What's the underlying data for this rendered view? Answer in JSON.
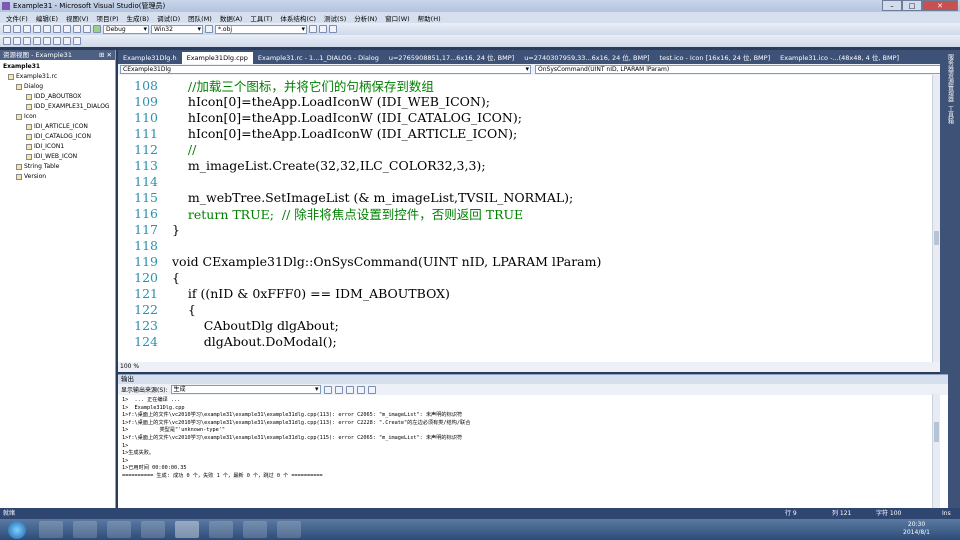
{
  "window": {
    "title": "Example31 - Microsoft Visual Studio(管理员)",
    "minimize": "–",
    "maximize": "□",
    "close": "✕"
  },
  "menu": [
    "文件(F)",
    "编辑(E)",
    "视图(V)",
    "项目(P)",
    "生成(B)",
    "调试(D)",
    "团队(M)",
    "数据(A)",
    "工具(T)",
    "体系结构(C)",
    "测试(S)",
    "分析(N)",
    "窗口(W)",
    "帮助(H)"
  ],
  "toolbar": {
    "config": "Debug",
    "platform": "Win32",
    "find": "*.obj"
  },
  "solution": {
    "header": "资源视图 - Example31",
    "items": [
      "Example31",
      "Example31.rc",
      "Dialog",
      "IDD_ABOUTBOX",
      "IDD_EXAMPLE31_DIALOG",
      "Icon",
      "IDI_ARTICLE_ICON",
      "IDI_CATALOG_ICON",
      "IDI_ICON1",
      "IDI_WEB_ICON",
      "String Table",
      "Version"
    ]
  },
  "tabs": [
    "Example31Dlg.h",
    "Example31Dlg.cpp",
    "Example31.rc - 1...1_DIALOG - Dialog",
    "u=2765908851,17...6x16, 24 位, BMP]",
    "u=2740307959,33...6x16, 24 位, BMP]",
    "test.ico - Icon [16x16, 24 位, BMP]",
    "Example31.ico -...(48x48, 4 位, BMP]"
  ],
  "nav": {
    "class": "CExample31Dlg",
    "member": "OnSysCommand(UINT nID, LPARAM lParam)"
  },
  "code": [
    {
      "n": "108",
      "t": "    //加载三个图标，并将它们的句柄保存到数组",
      "c": "cm"
    },
    {
      "n": "109",
      "t": "    hIcon[0]=theApp.LoadIconW (IDI_WEB_ICON);",
      "c": ""
    },
    {
      "n": "110",
      "t": "    hIcon[0]=theApp.LoadIconW (IDI_CATALOG_ICON);",
      "c": ""
    },
    {
      "n": "111",
      "t": "    hIcon[0]=theApp.LoadIconW (IDI_ARTICLE_ICON);",
      "c": ""
    },
    {
      "n": "112",
      "t": "    //",
      "c": "cm"
    },
    {
      "n": "113",
      "t": "    m_imageList.Create(32,32,ILC_COLOR32,3,3);",
      "c": ""
    },
    {
      "n": "114",
      "t": "",
      "c": ""
    },
    {
      "n": "115",
      "t": "    m_webTree.SetImageList (& m_imageList,TVSIL_NORMAL);",
      "c": ""
    },
    {
      "n": "116",
      "t": "    return TRUE;  // 除非将焦点设置到控件，否则返回 TRUE",
      "c": "mix"
    },
    {
      "n": "117",
      "t": "}",
      "c": ""
    },
    {
      "n": "118",
      "t": "",
      "c": ""
    },
    {
      "n": "119",
      "t": "void CExample31Dlg::OnSysCommand(UINT nID, LPARAM lParam)",
      "c": "fn"
    },
    {
      "n": "120",
      "t": "{",
      "c": ""
    },
    {
      "n": "121",
      "t": "    if ((nID & 0xFFF0) == IDM_ABOUTBOX)",
      "c": "if"
    },
    {
      "n": "122",
      "t": "    {",
      "c": ""
    },
    {
      "n": "123",
      "t": "        CAboutDlg dlgAbout;",
      "c": ""
    },
    {
      "n": "124",
      "t": "        dlgAbout.DoModal();",
      "c": ""
    }
  ],
  "zoom": "100 %",
  "output": {
    "header": "输出",
    "source_label": "显示输出来源(S):",
    "source": "生成",
    "lines": [
      "1>  ... 正在编译 ...",
      "1>  Example31Dlg.cpp",
      "1>f:\\桌面上的文件\\vc2010学习\\example31\\example31\\example31dlg.cpp(113): error C2065: \"m_imageList\": 未声明的标识符",
      "1>f:\\桌面上的文件\\vc2010学习\\example31\\example31\\example31dlg.cpp(113): error C2228: \".Create\"的左边必须有类/结构/联合",
      "1>          类型是\"'unknown-type'\"",
      "1>f:\\桌面上的文件\\vc2010学习\\example31\\example31\\example31dlg.cpp(115): error C2065: \"m_imageList\": 未声明的标识符",
      "1>",
      "1>生成失败。",
      "1>",
      "1>已用时间 00:00:00.35",
      "========== 生成: 成功 0 个，失败 1 个，最新 0 个，跳过 0 个 =========="
    ]
  },
  "rightstrip": [
    "服务器资源管理器",
    "工具箱"
  ],
  "status": {
    "left": "就绪",
    "row": "行 9",
    "col": "列 121",
    "ch": "字符 100",
    "ins": "Ins"
  },
  "tray": {
    "time": "20:30",
    "date": "2014/8/1"
  }
}
